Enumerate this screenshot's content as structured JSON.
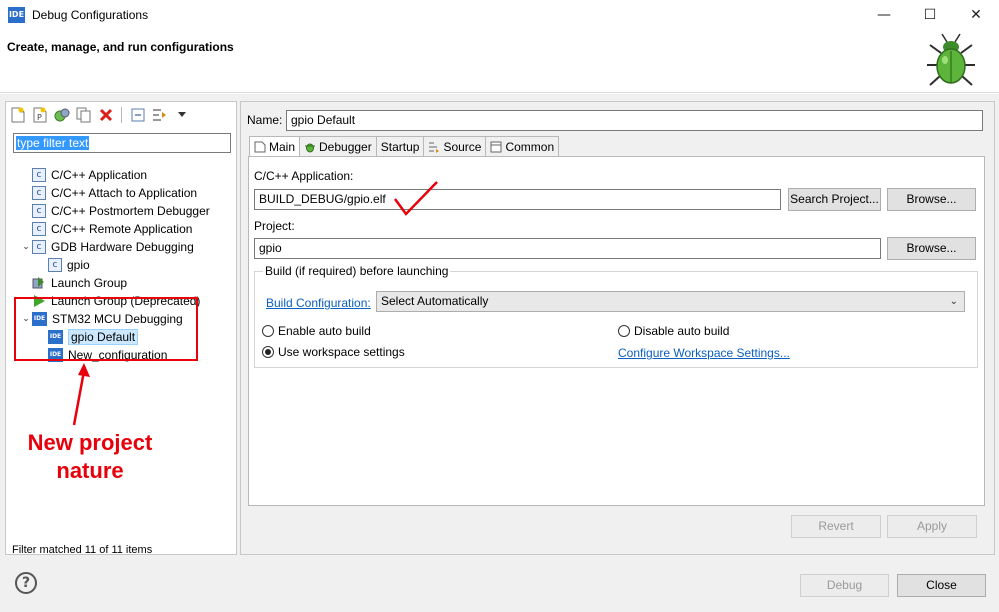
{
  "window": {
    "title": "Debug Configurations",
    "app_icon": "IDE",
    "minimize": "—",
    "maximize": "☐",
    "close": "✕"
  },
  "header": {
    "title": "Create, manage, and run configurations",
    "icon": "bug-icon"
  },
  "left": {
    "toolbar_icons": [
      "new-config-icon",
      "new-prototype-icon",
      "export-icon",
      "duplicate-icon",
      "delete-icon",
      "collapse-all-icon",
      "filter-icon",
      "dropdown-icon"
    ],
    "filter_placeholder": "type filter text",
    "tree": [
      {
        "label": "C/C++ Application",
        "icon": "c",
        "level": 1,
        "expanded": null
      },
      {
        "label": "C/C++ Attach to Application",
        "icon": "c",
        "level": 1,
        "expanded": null
      },
      {
        "label": "C/C++ Postmortem Debugger",
        "icon": "c",
        "level": 1,
        "expanded": null
      },
      {
        "label": "C/C++ Remote Application",
        "icon": "c",
        "level": 1,
        "expanded": null
      },
      {
        "label": "GDB Hardware Debugging",
        "icon": "c",
        "level": 1,
        "expanded": true
      },
      {
        "label": "gpio",
        "icon": "c",
        "level": 2,
        "expanded": null
      },
      {
        "label": "Launch Group",
        "icon": "launch",
        "level": 1,
        "expanded": null
      },
      {
        "label": "Launch Group (Deprecated)",
        "icon": "launch-green",
        "level": 1,
        "expanded": null
      },
      {
        "label": "STM32 MCU Debugging",
        "icon": "ide",
        "level": 1,
        "expanded": true
      },
      {
        "label": "gpio Default",
        "icon": "ide",
        "level": 2,
        "expanded": null,
        "selected": true
      },
      {
        "label": "New_configuration",
        "icon": "ide",
        "level": 2,
        "expanded": null
      }
    ],
    "status": "Filter matched 11 of 11 items",
    "annotation": "New project nature"
  },
  "right": {
    "name_label": "Name:",
    "name_value": "gpio Default",
    "tabs": [
      {
        "label": "Main",
        "icon": "main-tab-icon",
        "active": true
      },
      {
        "label": "Debugger",
        "icon": "debugger-tab-icon",
        "active": false
      },
      {
        "label": "Startup",
        "icon": "",
        "active": false
      },
      {
        "label": "Source",
        "icon": "source-tab-icon",
        "active": false
      },
      {
        "label": "Common",
        "icon": "common-tab-icon",
        "active": false
      }
    ],
    "app_label": "C/C++ Application:",
    "app_value": "BUILD_DEBUG/gpio.elf",
    "search_project": "Search Project...",
    "browse": "Browse...",
    "project_label": "Project:",
    "project_value": "gpio",
    "build_group_title": "Build (if required) before launching",
    "build_config_link": "Build Configuration:",
    "build_config_value": "Select Automatically",
    "enable_auto_build": "Enable auto build",
    "disable_auto_build": "Disable auto build",
    "use_workspace_settings": "Use workspace settings",
    "configure_workspace_link": "Configure Workspace Settings...",
    "revert": "Revert",
    "apply": "Apply"
  },
  "footer": {
    "help_icon": "?",
    "debug": "Debug",
    "close": "Close"
  },
  "colors": {
    "annotation": "#e8000b",
    "link": "#0b5fbf",
    "selection": "#3399ff"
  }
}
